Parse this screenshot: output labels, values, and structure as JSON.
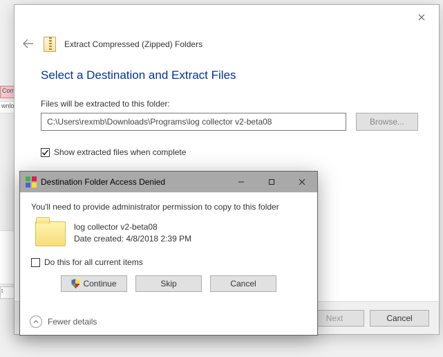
{
  "background": {
    "pink_label": "Com",
    "row_label": "wnloa",
    "stub_label": "t"
  },
  "wizard": {
    "window_title": "Extract Compressed (Zipped) Folders",
    "heading": "Select a Destination and Extract Files",
    "path_label": "Files will be extracted to this folder:",
    "path_value": "C:\\Users\\rexmb\\Downloads\\Programs\\log collector v2-beta08",
    "browse_label": "Browse...",
    "show_files_checked": true,
    "show_files_label": "Show extracted files when complete",
    "next_label": "Next",
    "cancel_label": "Cancel"
  },
  "subdialog": {
    "title": "Destination Folder Access Denied",
    "message": "You'll need to provide administrator permission to copy to this folder",
    "folder_name": "log collector v2-beta08",
    "date_created_label": "Date created: 4/8/2018 2:39 PM",
    "do_all_label": "Do this for all current items",
    "do_all_checked": false,
    "continue_label": "Continue",
    "skip_label": "Skip",
    "cancel_label": "Cancel",
    "fewer_label": "Fewer details"
  }
}
